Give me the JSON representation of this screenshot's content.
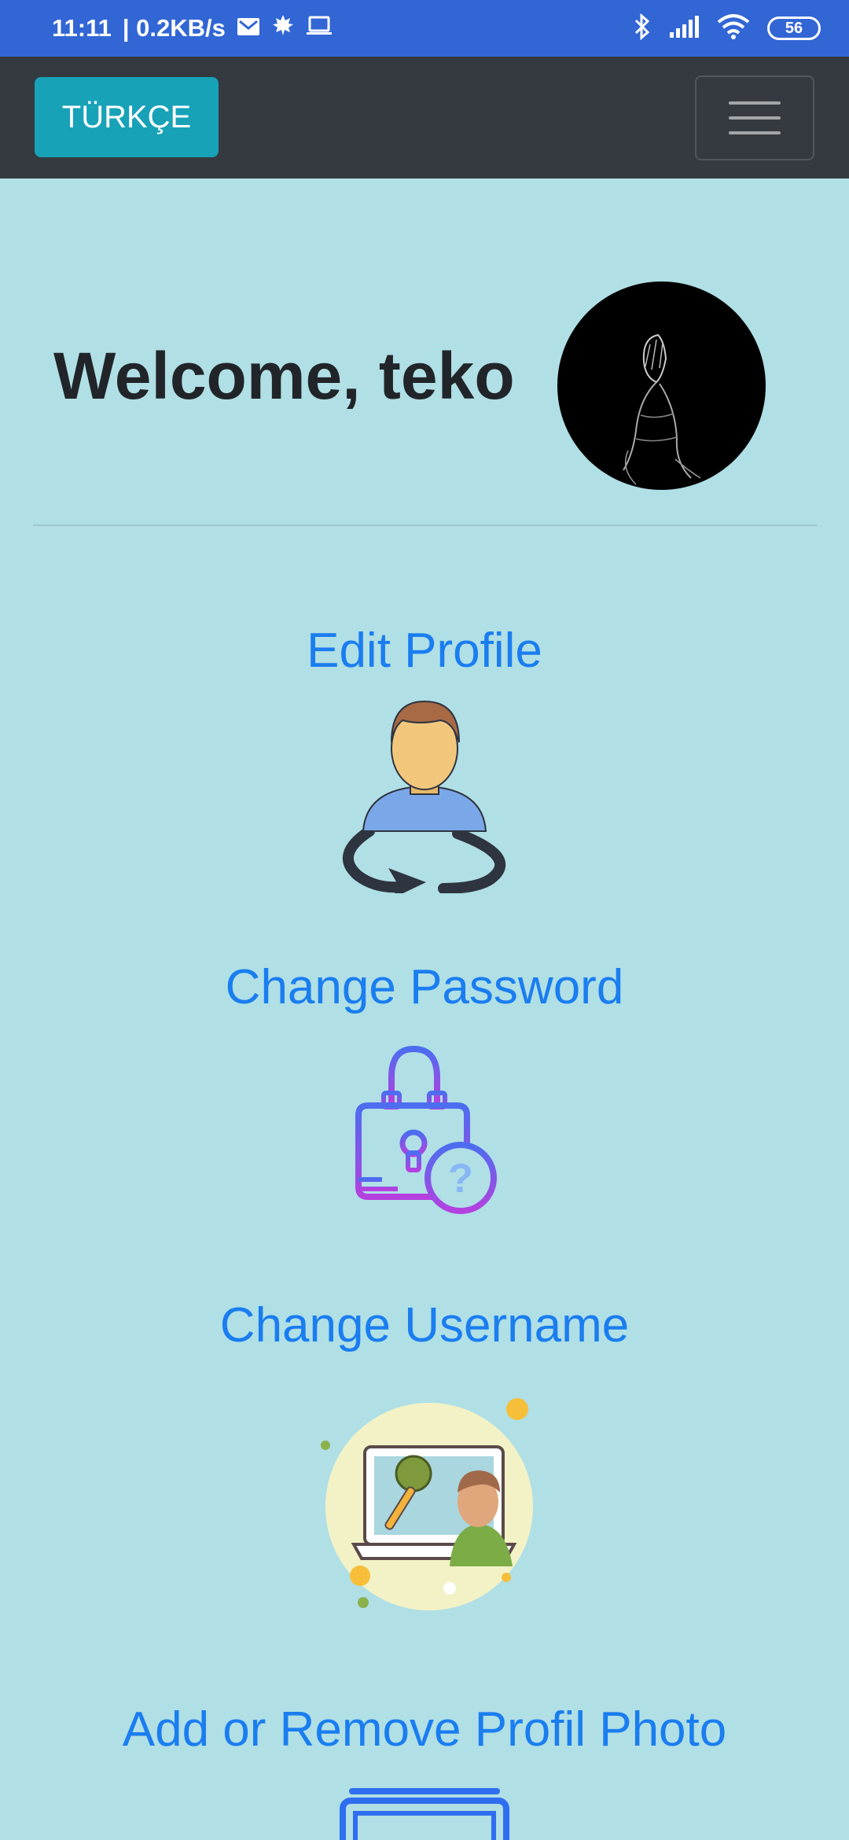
{
  "status_bar": {
    "time": "11:11",
    "speed": "| 0.2KB/s",
    "battery": "56",
    "icons": [
      "mail-icon",
      "leaf-icon",
      "laptop-icon",
      "bluetooth-icon",
      "signal-icon",
      "wifi-icon",
      "battery-icon"
    ]
  },
  "navbar": {
    "language_button": "TÜRKÇE",
    "menu_icon": "hamburger-icon",
    "colors": {
      "background": "#343a40",
      "button": "#17a2b8"
    }
  },
  "profile": {
    "welcome": "Welcome, teko",
    "avatar_icon": "avatar-icon"
  },
  "links": [
    {
      "label": "Edit Profile",
      "icon": "edit-profile-icon"
    },
    {
      "label": "Change Password",
      "icon": "lock-question-icon"
    },
    {
      "label": "Change Username",
      "icon": "username-icon"
    },
    {
      "label": "Add or Remove Profil Photo",
      "icon": "photo-icon"
    }
  ],
  "colors": {
    "page_background": "#b0dfe5",
    "link": "#1a7df0",
    "status_bar": "#3266d5"
  }
}
